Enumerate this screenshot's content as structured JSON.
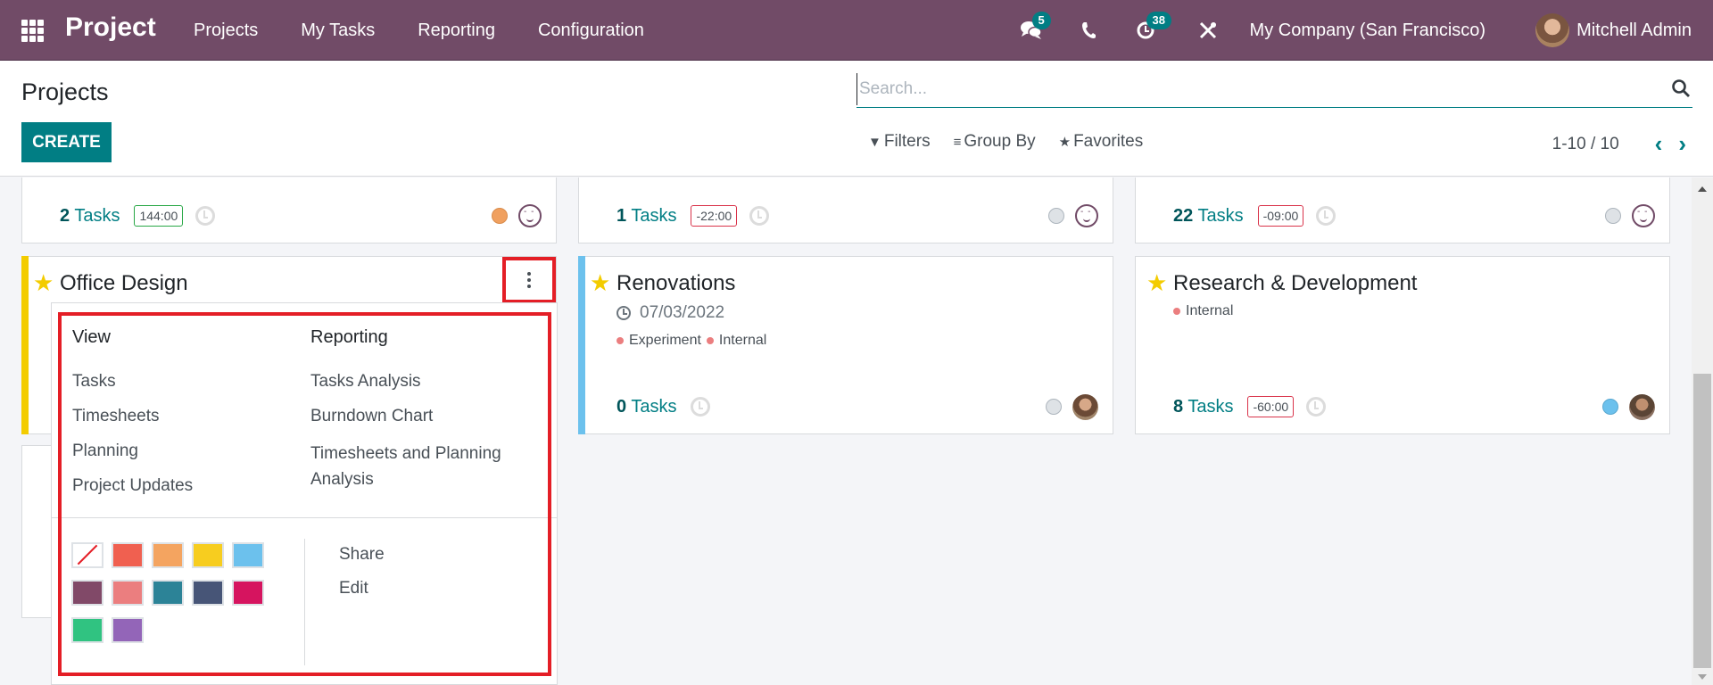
{
  "navbar": {
    "app_name": "Project",
    "menu": [
      "Projects",
      "My Tasks",
      "Reporting",
      "Configuration"
    ],
    "messages_count": "5",
    "activities_count": "38",
    "company": "My Company (San Francisco)",
    "user": "Mitchell Admin"
  },
  "control_panel": {
    "title": "Projects",
    "create_label": "CREATE",
    "search_placeholder": "Search...",
    "filters_label": "Filters",
    "groupby_label": "Group By",
    "favorites_label": "Favorites",
    "pager_value": "1-10 / 10"
  },
  "cards_top": [
    {
      "tasks_count": "2",
      "tasks_label": "Tasks",
      "hours": "144:00",
      "hours_positive": true,
      "status_color": "#f0a05f"
    },
    {
      "tasks_count": "1",
      "tasks_label": "Tasks",
      "hours": "-22:00",
      "hours_positive": false,
      "status_color": "#dee2e6"
    },
    {
      "tasks_count": "22",
      "tasks_label": "Tasks",
      "hours": "-09:00",
      "hours_positive": false,
      "status_color": "#dee2e6"
    }
  ],
  "cards": [
    {
      "name": "Office Design",
      "favorite": true,
      "color": "#f3cc00"
    },
    {
      "name": "Renovations",
      "favorite": true,
      "color": "#6cc1ed",
      "date": "07/03/2022",
      "tags": [
        "Experiment",
        "Internal"
      ],
      "tasks_count": "0",
      "tasks_label": "Tasks",
      "status_color": "#dee2e6"
    },
    {
      "name": "Research & Development",
      "favorite": true,
      "tags": [
        "Internal"
      ],
      "tasks_count": "8",
      "tasks_label": "Tasks",
      "hours": "-60:00",
      "status_color": "#6cc1ed"
    }
  ],
  "dropdown": {
    "view_header": "View",
    "view_items": [
      "Tasks",
      "Timesheets",
      "Planning",
      "Project Updates"
    ],
    "reporting_header": "Reporting",
    "reporting_items": [
      "Tasks Analysis",
      "Burndown Chart",
      "Timesheets and Planning Analysis"
    ],
    "colors": [
      "none",
      "#f06050",
      "#f4a460",
      "#f7cd1f",
      "#6cc1ed",
      "#814968",
      "#eb7e7f",
      "#2c8397",
      "#475577",
      "#d6145f",
      "#30c381",
      "#9365b8"
    ],
    "actions": [
      "Share",
      "Edit"
    ]
  }
}
